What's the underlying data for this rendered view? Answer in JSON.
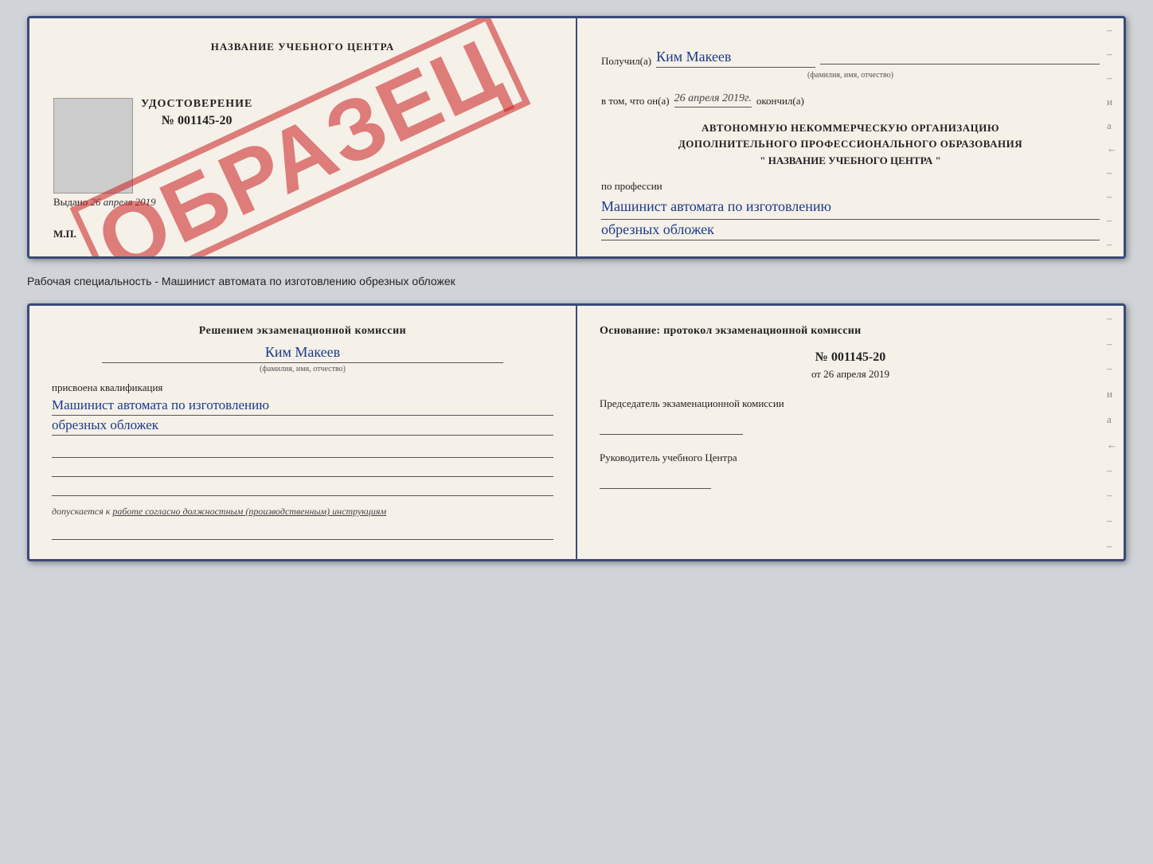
{
  "top_doc": {
    "left": {
      "title": "НАЗВАНИЕ УЧЕБНОГО ЦЕНТРА",
      "stamp": "ОБРАЗЕЦ",
      "udost_title": "УДОСТОВЕРЕНИЕ",
      "udost_number": "№ 001145-20",
      "vydano_label": "Выдано",
      "vydano_date": "26 апреля 2019",
      "mp": "М.П."
    },
    "right": {
      "poluchil_label": "Получил(а)",
      "recipient_name": "Ким Макеев",
      "fio_hint": "(фамилия, имя, отчество)",
      "vtom_label": "в том, что он(а)",
      "completion_date": "26 апреля 2019г.",
      "okonchil_label": "окончил(а)",
      "org_line1": "АВТОНОМНУЮ НЕКОММЕРЧЕСКУЮ ОРГАНИЗАЦИЮ",
      "org_line2": "ДОПОЛНИТЕЛЬНОГО ПРОФЕССИОНАЛЬНОГО ОБРАЗОВАНИЯ",
      "org_name": "\"  НАЗВАНИЕ УЧЕБНОГО ЦЕНТРА  \"",
      "po_professii_label": "по профессии",
      "profession_line1": "Машинист автомата по изготовлению",
      "profession_line2": "обрезных обложек",
      "margin_dashes": [
        "–",
        "–",
        "–",
        "и",
        "а",
        "←",
        "–",
        "–",
        "–",
        "–"
      ]
    }
  },
  "caption": {
    "text": "Рабочая специальность - Машинист автомата по изготовлению обрезных обложек"
  },
  "bottom_doc": {
    "left": {
      "resheniem_title": "Решением экзаменационной комиссии",
      "komissia_name": "Ким Макеев",
      "fio_hint": "(фамилия, имя, отчество)",
      "prisvoena_label": "присвоена квалификация",
      "qual_line1": "Машинист автомата по изготовлению",
      "qual_line2": "обрезных обложек",
      "blank_lines": 3,
      "dopuskaetsya_label": "допускается к",
      "dopuskaetsya_text": "работе согласно должностным (производственным) инструкциям"
    },
    "right": {
      "osnovanie_title": "Основание: протокол экзаменационной комиссии",
      "protocol_number": "№  001145-20",
      "ot_label": "от",
      "ot_date": "26 апреля 2019",
      "predsedatel_label": "Председатель экзаменационной комиссии",
      "rukovoditel_label": "Руководитель учебного Центра",
      "margin_dashes": [
        "–",
        "–",
        "–",
        "и",
        "а",
        "←",
        "–",
        "–",
        "–",
        "–"
      ]
    }
  }
}
